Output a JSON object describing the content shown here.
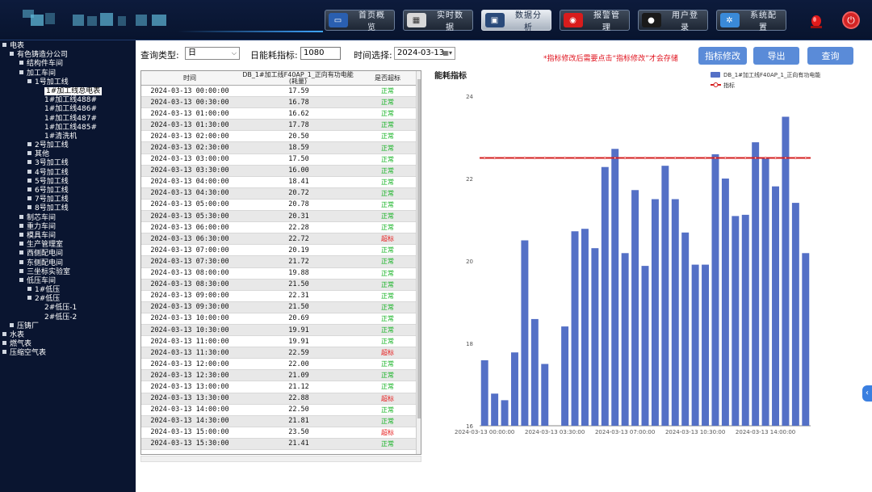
{
  "nav": {
    "items": [
      {
        "label": "首页概览",
        "icon": "monitor-icon",
        "color": "#2a5fb0"
      },
      {
        "label": "实时数据",
        "icon": "calendar-icon",
        "color": "#d8d8d8"
      },
      {
        "label": "数据分析",
        "icon": "computer-icon",
        "color": "#2a4a7a",
        "active": true
      },
      {
        "label": "报警管理",
        "icon": "alarm-icon",
        "color": "#d81c1c"
      },
      {
        "label": "用户登录",
        "icon": "user-icon",
        "color": "#1a1a1a"
      },
      {
        "label": "系统配置",
        "icon": "gear-icon",
        "color": "#3a8ad8"
      }
    ]
  },
  "sidebar": {
    "items": [
      {
        "label": "电表",
        "level": 0,
        "toggle": true
      },
      {
        "label": "有色铸造分公司",
        "level": 1,
        "toggle": true
      },
      {
        "label": "结构件车间",
        "level": 2,
        "toggle": true
      },
      {
        "label": "加工车间",
        "level": 2,
        "toggle": true
      },
      {
        "label": "1号加工线",
        "level": 3,
        "toggle": true
      },
      {
        "label": "1#加工线总电表",
        "level": 4,
        "toggle": false,
        "selected": true
      },
      {
        "label": "1#加工线488#",
        "level": 4,
        "toggle": false
      },
      {
        "label": "1#加工线486#",
        "level": 4,
        "toggle": false
      },
      {
        "label": "1#加工线487#",
        "level": 4,
        "toggle": false
      },
      {
        "label": "1#加工线485#",
        "level": 4,
        "toggle": false
      },
      {
        "label": "1#清洗机",
        "level": 4,
        "toggle": false
      },
      {
        "label": "2号加工线",
        "level": 3,
        "toggle": true
      },
      {
        "label": "其他",
        "level": 3,
        "toggle": true
      },
      {
        "label": "3号加工线",
        "level": 3,
        "toggle": true
      },
      {
        "label": "4号加工线",
        "level": 3,
        "toggle": true
      },
      {
        "label": "5号加工线",
        "level": 3,
        "toggle": true
      },
      {
        "label": "6号加工线",
        "level": 3,
        "toggle": true
      },
      {
        "label": "7号加工线",
        "level": 3,
        "toggle": true
      },
      {
        "label": "8号加工线",
        "level": 3,
        "toggle": true
      },
      {
        "label": "制芯车间",
        "level": 2,
        "toggle": true
      },
      {
        "label": "重力车间",
        "level": 2,
        "toggle": true
      },
      {
        "label": "模具车间",
        "level": 2,
        "toggle": true
      },
      {
        "label": "生产管理室",
        "level": 2,
        "toggle": true
      },
      {
        "label": "西侧配电间",
        "level": 2,
        "toggle": true
      },
      {
        "label": "东侧配电间",
        "level": 2,
        "toggle": true
      },
      {
        "label": "三坐标实验室",
        "level": 2,
        "toggle": true
      },
      {
        "label": "低压车间",
        "level": 2,
        "toggle": true
      },
      {
        "label": "1#低压",
        "level": 3,
        "toggle": true
      },
      {
        "label": "2#低压",
        "level": 3,
        "toggle": true
      },
      {
        "label": "2#低压-1",
        "level": 4,
        "toggle": false
      },
      {
        "label": "2#低压-2",
        "level": 4,
        "toggle": false
      },
      {
        "label": "压铸厂",
        "level": 1,
        "toggle": true
      },
      {
        "label": "水表",
        "level": 0,
        "toggle": true
      },
      {
        "label": "燃气表",
        "level": 0,
        "toggle": true
      },
      {
        "label": "压缩空气表",
        "level": 0,
        "toggle": true
      }
    ]
  },
  "query": {
    "type_label": "查询类型:",
    "type_value": "日",
    "index_label": "日能耗指标:",
    "index_value": "1080",
    "time_label": "时间选择:",
    "time_value": "2024-03-13",
    "notice": "*指标修改后需要点击“指标修改”才会存储",
    "btn_modify": "指标修改",
    "btn_export": "导出",
    "btn_query": "查询"
  },
  "table": {
    "headers": [
      "时间",
      "DB_1#加工线F40AP_1_正向有功电能(耗量)",
      "是否超标"
    ],
    "rows": [
      {
        "time": "2024-03-13 00:00:00",
        "value": "17.59",
        "status": "正常"
      },
      {
        "time": "2024-03-13 00:30:00",
        "value": "16.78",
        "status": "正常"
      },
      {
        "time": "2024-03-13 01:00:00",
        "value": "16.62",
        "status": "正常"
      },
      {
        "time": "2024-03-13 01:30:00",
        "value": "17.78",
        "status": "正常"
      },
      {
        "time": "2024-03-13 02:00:00",
        "value": "20.50",
        "status": "正常"
      },
      {
        "time": "2024-03-13 02:30:00",
        "value": "18.59",
        "status": "正常"
      },
      {
        "time": "2024-03-13 03:00:00",
        "value": "17.50",
        "status": "正常"
      },
      {
        "time": "2024-03-13 03:30:00",
        "value": "16.00",
        "status": "正常"
      },
      {
        "time": "2024-03-13 04:00:00",
        "value": "18.41",
        "status": "正常"
      },
      {
        "time": "2024-03-13 04:30:00",
        "value": "20.72",
        "status": "正常"
      },
      {
        "time": "2024-03-13 05:00:00",
        "value": "20.78",
        "status": "正常"
      },
      {
        "time": "2024-03-13 05:30:00",
        "value": "20.31",
        "status": "正常"
      },
      {
        "time": "2024-03-13 06:00:00",
        "value": "22.28",
        "status": "正常"
      },
      {
        "time": "2024-03-13 06:30:00",
        "value": "22.72",
        "status": "超标"
      },
      {
        "time": "2024-03-13 07:00:00",
        "value": "20.19",
        "status": "正常"
      },
      {
        "time": "2024-03-13 07:30:00",
        "value": "21.72",
        "status": "正常"
      },
      {
        "time": "2024-03-13 08:00:00",
        "value": "19.88",
        "status": "正常"
      },
      {
        "time": "2024-03-13 08:30:00",
        "value": "21.50",
        "status": "正常"
      },
      {
        "time": "2024-03-13 09:00:00",
        "value": "22.31",
        "status": "正常"
      },
      {
        "time": "2024-03-13 09:30:00",
        "value": "21.50",
        "status": "正常"
      },
      {
        "time": "2024-03-13 10:00:00",
        "value": "20.69",
        "status": "正常"
      },
      {
        "time": "2024-03-13 10:30:00",
        "value": "19.91",
        "status": "正常"
      },
      {
        "time": "2024-03-13 11:00:00",
        "value": "19.91",
        "status": "正常"
      },
      {
        "time": "2024-03-13 11:30:00",
        "value": "22.59",
        "status": "超标"
      },
      {
        "time": "2024-03-13 12:00:00",
        "value": "22.00",
        "status": "正常"
      },
      {
        "time": "2024-03-13 12:30:00",
        "value": "21.09",
        "status": "正常"
      },
      {
        "time": "2024-03-13 13:00:00",
        "value": "21.12",
        "status": "正常"
      },
      {
        "time": "2024-03-13 13:30:00",
        "value": "22.88",
        "status": "超标"
      },
      {
        "time": "2024-03-13 14:00:00",
        "value": "22.50",
        "status": "正常"
      },
      {
        "time": "2024-03-13 14:30:00",
        "value": "21.81",
        "status": "正常"
      },
      {
        "time": "2024-03-13 15:00:00",
        "value": "23.50",
        "status": "超标"
      },
      {
        "time": "2024-03-13 15:30:00",
        "value": "21.41",
        "status": "正常"
      }
    ]
  },
  "colors": {
    "bar": "#5470c6",
    "threshold": "#d41f1f",
    "ok": "#0fb01e",
    "over": "#e51a1a",
    "accent": "#5a8bd8"
  },
  "chart_data": {
    "type": "bar",
    "title": "能耗指标",
    "x": [
      "2024-03-13 00:00:00",
      "2024-03-13 00:30:00",
      "2024-03-13 01:00:00",
      "2024-03-13 01:30:00",
      "2024-03-13 02:00:00",
      "2024-03-13 02:30:00",
      "2024-03-13 03:00:00",
      "2024-03-13 03:30:00",
      "2024-03-13 04:00:00",
      "2024-03-13 04:30:00",
      "2024-03-13 05:00:00",
      "2024-03-13 05:30:00",
      "2024-03-13 06:00:00",
      "2024-03-13 06:30:00",
      "2024-03-13 07:00:00",
      "2024-03-13 07:30:00",
      "2024-03-13 08:00:00",
      "2024-03-13 08:30:00",
      "2024-03-13 09:00:00",
      "2024-03-13 09:30:00",
      "2024-03-13 10:00:00",
      "2024-03-13 10:30:00",
      "2024-03-13 11:00:00",
      "2024-03-13 11:30:00",
      "2024-03-13 12:00:00",
      "2024-03-13 12:30:00",
      "2024-03-13 13:00:00",
      "2024-03-13 13:30:00",
      "2024-03-13 14:00:00",
      "2024-03-13 14:30:00",
      "2024-03-13 15:00:00",
      "2024-03-13 15:30:00"
    ],
    "series": [
      {
        "name": "DB_1#加工线F40AP_1_正向有功电能",
        "type": "bar",
        "values": [
          17.59,
          16.78,
          16.62,
          17.78,
          20.5,
          18.59,
          17.5,
          16.0,
          18.41,
          20.72,
          20.78,
          20.31,
          22.28,
          22.72,
          20.19,
          21.72,
          19.88,
          21.5,
          22.31,
          21.5,
          20.69,
          19.91,
          19.91,
          22.59,
          22.0,
          21.09,
          21.12,
          22.88,
          22.5,
          21.81,
          23.5,
          21.41,
          20.19
        ]
      },
      {
        "name": "指标",
        "type": "line",
        "value": 22.5
      }
    ],
    "tick_labels": [
      "2024-03-13 00:00:00",
      "2024-03-13 03:30:00",
      "2024-03-13 07:00:00",
      "2024-03-13 10:30:00",
      "2024-03-13 14:00:00"
    ],
    "ylim": [
      16,
      24
    ],
    "yticks": [
      16,
      18,
      20,
      22,
      24
    ],
    "grid": false,
    "legend": "top-right"
  }
}
